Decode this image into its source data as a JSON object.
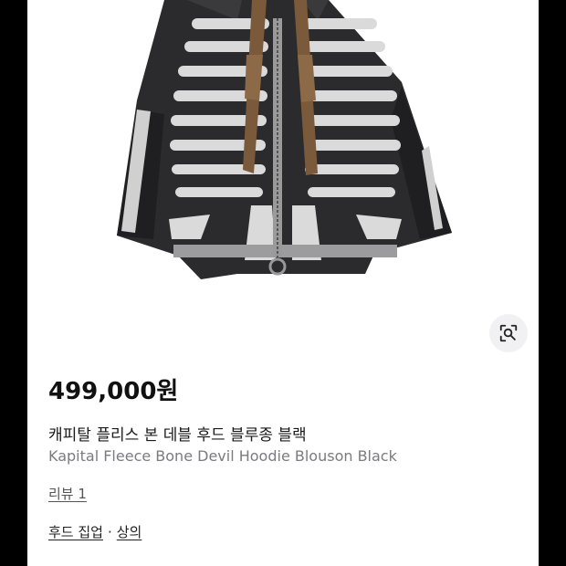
{
  "product": {
    "price": "499,000원",
    "title_ko": "캐피탈 플리스 본 데블 후드 블루종 블랙",
    "title_en": "Kapital Fleece Bone Devil Hoodie Blouson Black",
    "review_link": "리뷰 1",
    "categories": [
      "후드 집업",
      "상의"
    ],
    "category_separator": "·"
  },
  "icons": {
    "image_search": "lens-search-icon"
  },
  "colors": {
    "background": "#000000",
    "card": "#ffffff",
    "garment": "#2a2a2c",
    "bone": "#d9d9d9",
    "strap": "#7a5a3a"
  }
}
